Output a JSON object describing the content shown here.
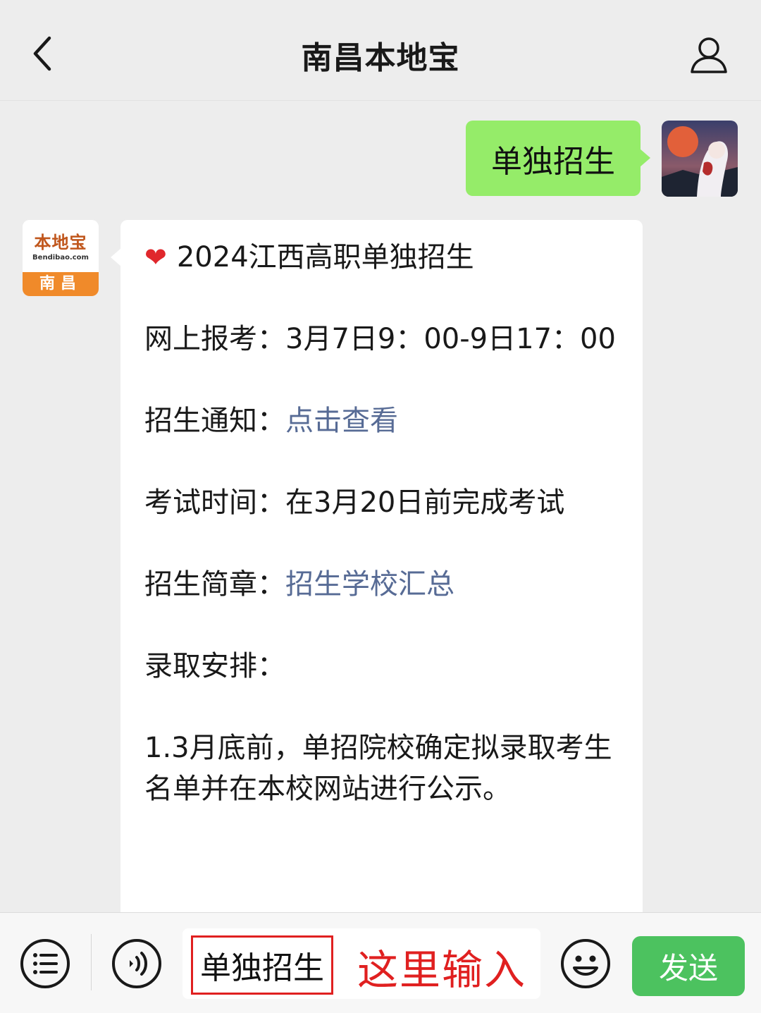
{
  "header": {
    "title": "南昌本地宝"
  },
  "user_message": {
    "text": "单独招生"
  },
  "bot_avatar": {
    "logo_text": "本地宝",
    "logo_sub": "Bendibao.com",
    "city": "南昌"
  },
  "bot_message": {
    "heading": "2024江西高职单独招生",
    "online_registration": "网上报考：3月7日9：00-9日17：00",
    "notice_label": "招生通知：",
    "notice_link": "点击查看",
    "exam_time": "考试时间：在3月20日前完成考试",
    "brochure_label": "招生简章：",
    "brochure_link": "招生学校汇总",
    "admission_label": "录取安排：",
    "admission_item_1": "1.3月底前，单招院校确定拟录取考生名单并在本校网站进行公示。"
  },
  "input_bar": {
    "input_value": "单独招生",
    "annotation": "这里输入",
    "send_label": "发送"
  },
  "colors": {
    "user_bubble": "#95ec69",
    "link": "#576b95",
    "send_button": "#4cc25f",
    "annotation": "#e02020"
  }
}
